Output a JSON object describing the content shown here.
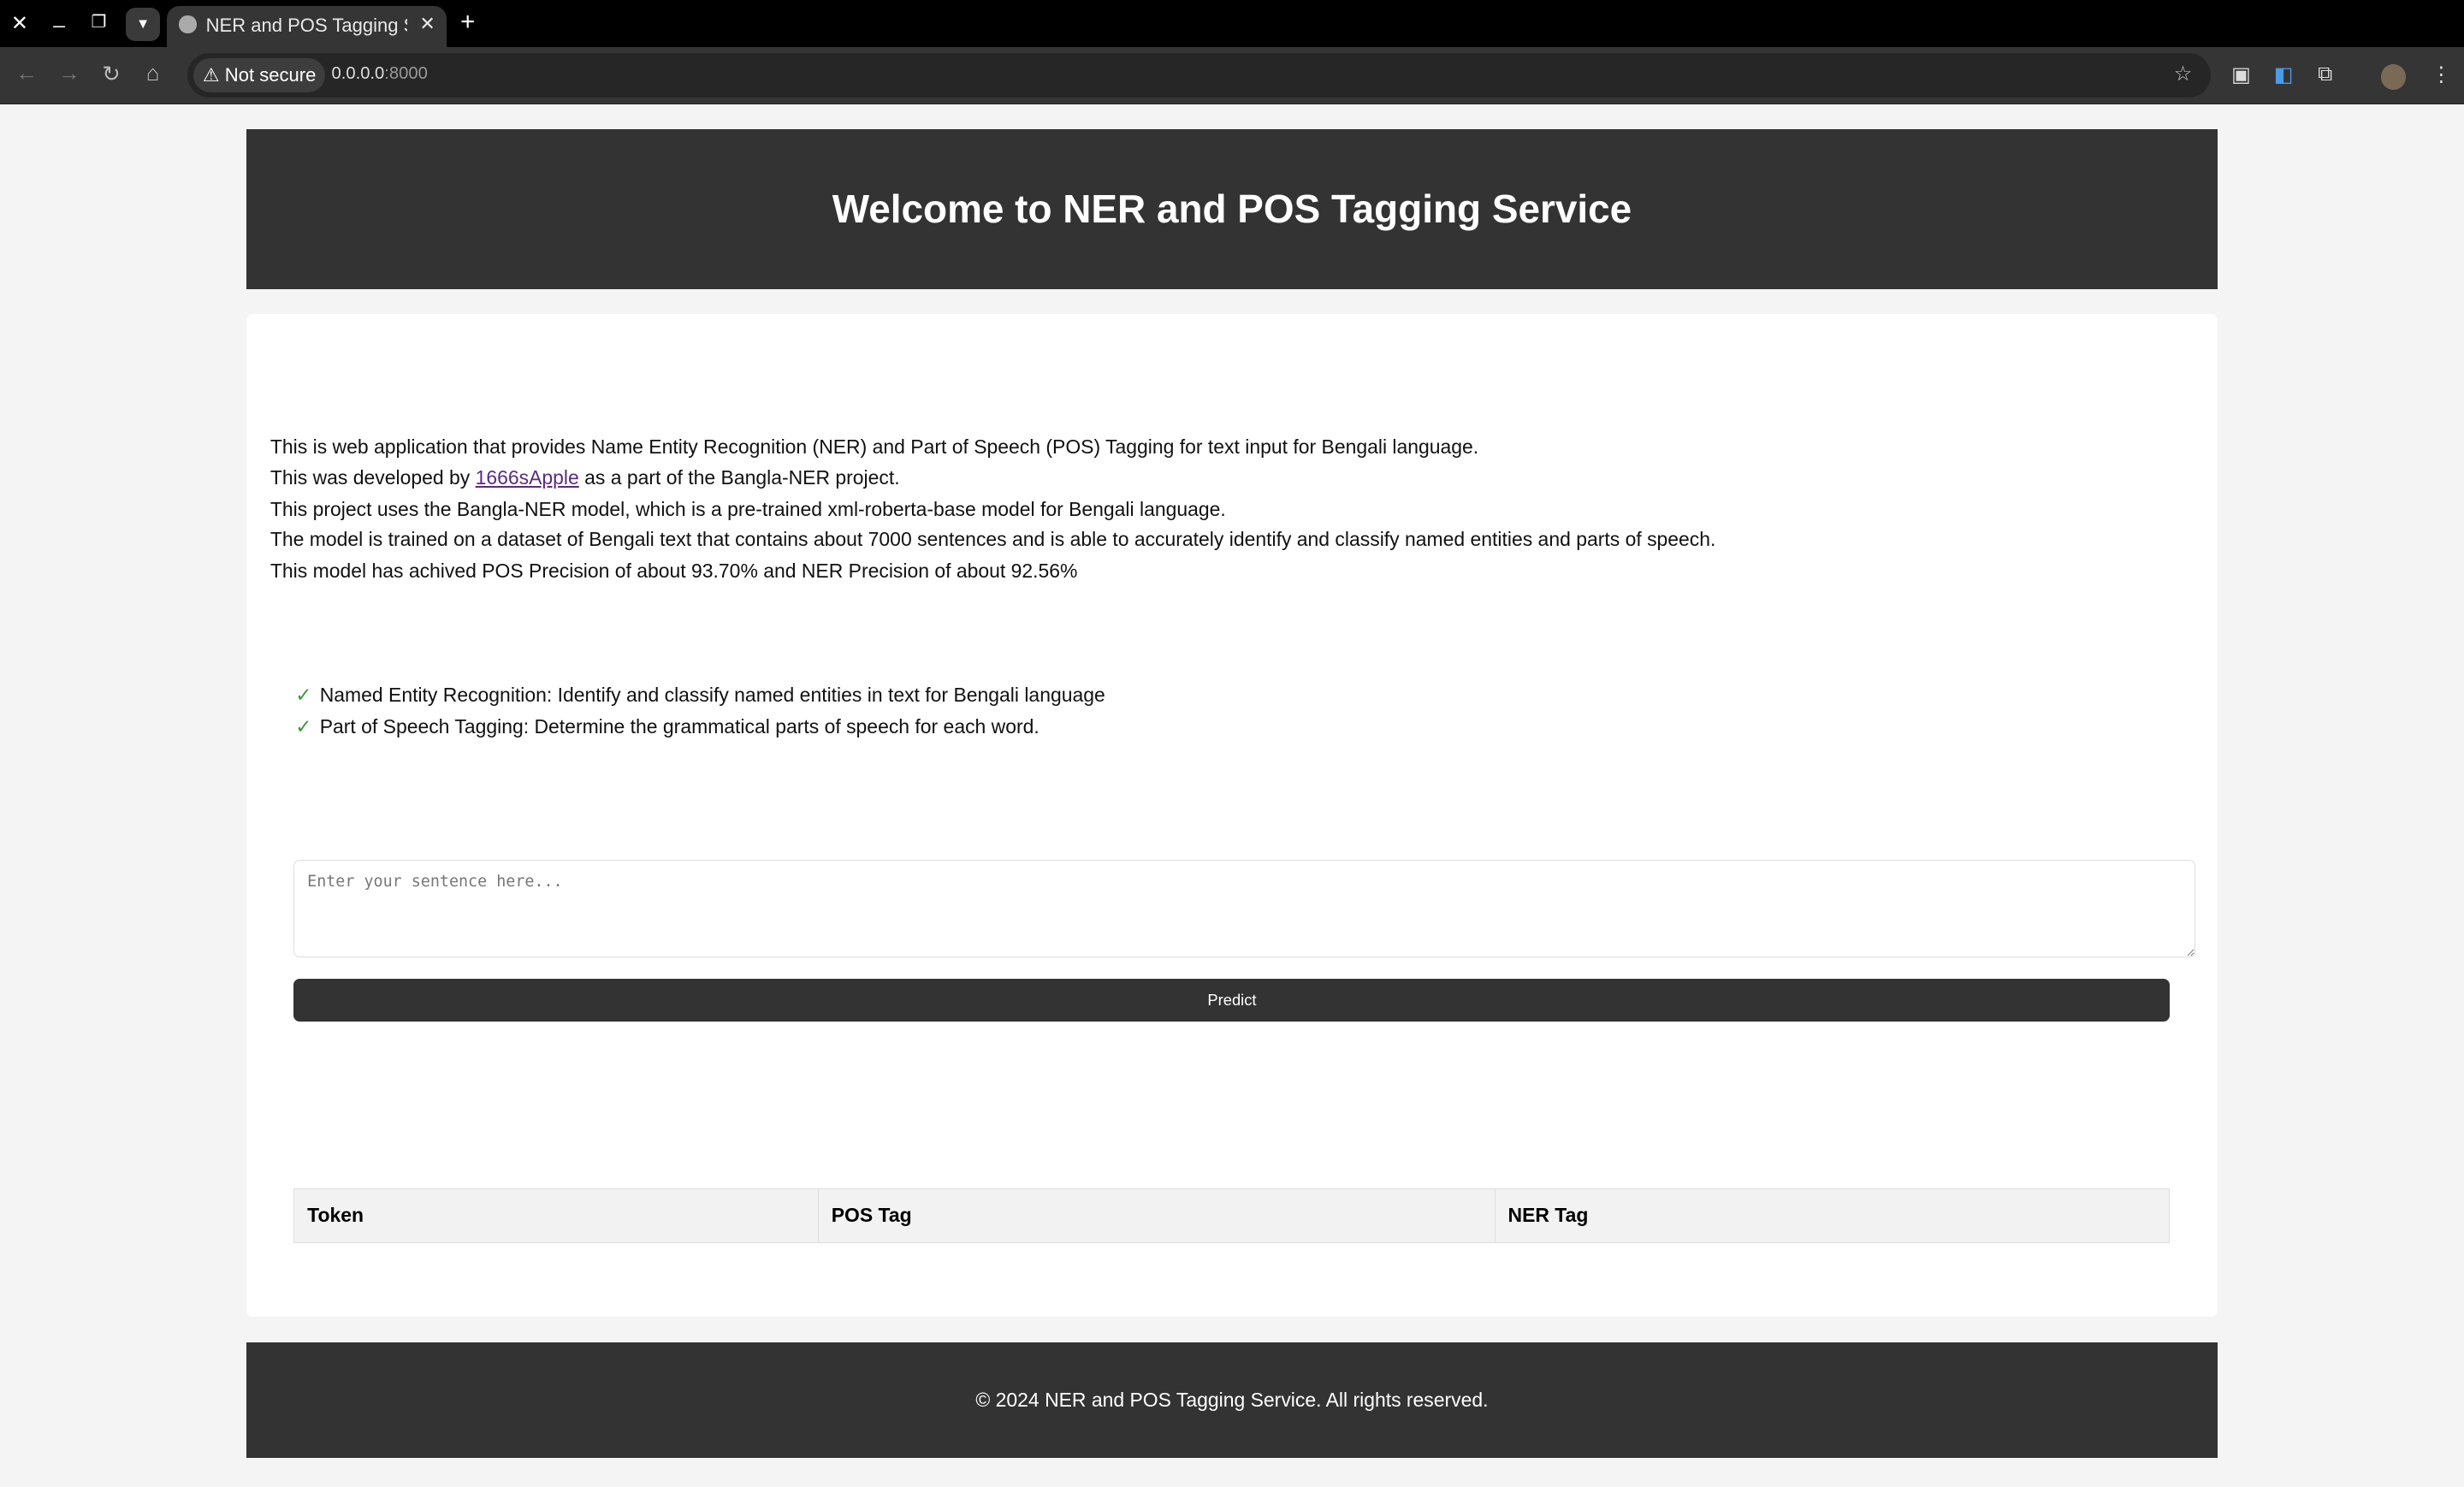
{
  "browser": {
    "tab_title": "NER and POS Tagging Service",
    "security": "Not secure",
    "url_host": "0.0.0.0",
    "url_port": ":8000"
  },
  "header": {
    "title": "Welcome to NER and POS Tagging Service"
  },
  "intro": {
    "line1": "This is web application that provides Name Entity Recognition (NER) and Part of Speech (POS) Tagging for text input for Bengali language.",
    "line2_before": "This was developed by ",
    "line2_link": "1666sApple",
    "line2_after": " as a part of the Bangla-NER project.",
    "line3": "This project uses the Bangla-NER model, which is a pre-trained xml-roberta-base model for Bengali language.",
    "line4": "The model is trained on a dataset of Bengali text that contains about 7000 sentences and is able to accurately identify and classify named entities and parts of speech.",
    "line5": "This model has achived POS Precision of about 93.70% and NER Precision of about 92.56%"
  },
  "features": [
    {
      "check": "✓",
      "text": "Named Entity Recognition: Identify and classify named entities in text for Bengali language"
    },
    {
      "check": "✓",
      "text": "Part of Speech Tagging: Determine the grammatical parts of speech for each word."
    }
  ],
  "form": {
    "placeholder": "Enter your sentence here...",
    "value": "",
    "predict_label": "Predict"
  },
  "table": {
    "headers": [
      "Token",
      "POS Tag",
      "NER Tag"
    ]
  },
  "footer": {
    "text": "© 2024 NER and POS Tagging Service. All rights reserved."
  }
}
